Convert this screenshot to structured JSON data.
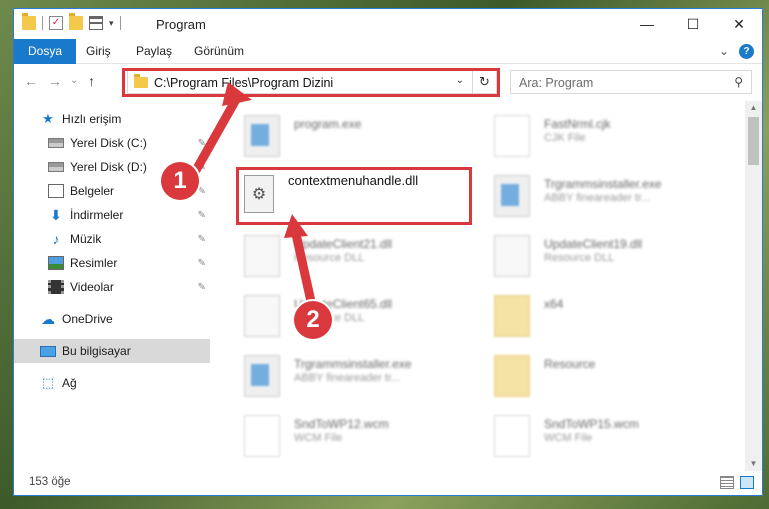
{
  "window": {
    "title": "Program",
    "controls": {
      "minimize": "—",
      "maximize": "☐",
      "close": "✕"
    }
  },
  "ribbon": {
    "tabs": [
      "Dosya",
      "Giriş",
      "Paylaş",
      "Görünüm"
    ],
    "expand": "⌄",
    "help": "?"
  },
  "nav": {
    "back": "←",
    "forward": "→",
    "recent": "⌄",
    "up": "↑",
    "address": "C:\\Program Files\\Program Dizini",
    "dropdown": "⌄",
    "refresh": "↻",
    "search_placeholder": "Ara: Program",
    "search_icon": "⚲"
  },
  "sidebar": {
    "items": [
      {
        "label": "Hızlı erişim",
        "icon": "star-icon"
      },
      {
        "label": "Yerel Disk (C:)",
        "icon": "disk-icon",
        "pin": "✎"
      },
      {
        "label": "Yerel Disk (D:)",
        "icon": "disk-icon",
        "pin": "✎"
      },
      {
        "label": "Belgeler",
        "icon": "documents-icon",
        "pin": "✎"
      },
      {
        "label": "İndirmeler",
        "icon": "downloads-icon",
        "pin": "✎"
      },
      {
        "label": "Müzik",
        "icon": "music-icon",
        "pin": "✎"
      },
      {
        "label": "Resimler",
        "icon": "pictures-icon",
        "pin": "✎"
      },
      {
        "label": "Videolar",
        "icon": "videos-icon",
        "pin": "✎"
      },
      {
        "label": "OneDrive",
        "icon": "onedrive-icon"
      },
      {
        "label": "Bu bilgisayar",
        "icon": "this-pc-icon",
        "selected": true
      },
      {
        "label": "Ağ",
        "icon": "network-icon"
      }
    ]
  },
  "files": [
    {
      "name": "program.exe",
      "type": "",
      "icon": "exe-icon"
    },
    {
      "name": "FastNrml.cjk",
      "type": "CJK File",
      "icon": "generic-file-icon"
    },
    {
      "name": "Trgrammsinstaller.exe",
      "type": "ABBY fineareader tr...",
      "icon": "exe-icon"
    },
    {
      "name": "UpdateClient21.dll",
      "type": "Resource DLL",
      "icon": "dll-icon"
    },
    {
      "name": "UpdateClient19.dll",
      "type": "Resource DLL",
      "icon": "dll-icon"
    },
    {
      "name": "UpdateClient65.dll",
      "type": "Resource DLL",
      "icon": "dll-icon"
    },
    {
      "name": "x64",
      "type": "",
      "icon": "folder-icon"
    },
    {
      "name": "Trgrammsinstaller.exe",
      "type": "ABBY fineareader tr...",
      "icon": "exe-icon"
    },
    {
      "name": "Resource",
      "type": "",
      "icon": "folder-icon"
    },
    {
      "name": "SndToWP12.wcm",
      "type": "WCM File",
      "icon": "generic-file-icon"
    },
    {
      "name": "SndToWP15.wcm",
      "type": "WCM File",
      "icon": "generic-file-icon"
    }
  ],
  "highlighted_file": {
    "name": "contextmenuhandle.dll",
    "icon_glyph": "⚙"
  },
  "annotations": {
    "step1": "1",
    "step2": "2",
    "accent": "#d9393d"
  },
  "status": {
    "count": "153 öğe"
  }
}
